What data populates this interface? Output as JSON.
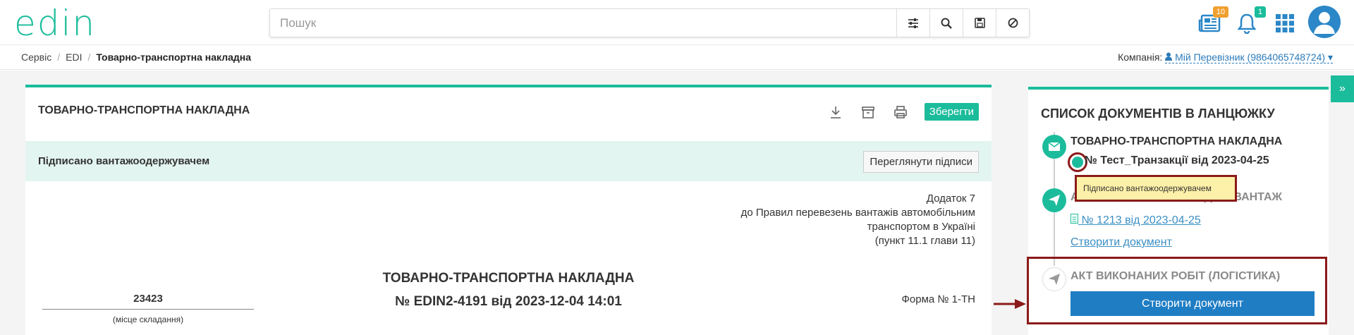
{
  "header": {
    "logo_text": "edin",
    "search_placeholder": "Пошук",
    "news_badge": "10",
    "notif_badge": "1"
  },
  "breadcrumb": [
    "Сервіс",
    "EDI",
    "Товарно-транспортна накладна"
  ],
  "company": {
    "label": "Компанія:",
    "value": "Мій Перевізник (9864065748724)"
  },
  "document": {
    "panel_title": "ТОВАРНО-ТРАНСПОРТНА НАКЛАДНА",
    "save_label": "Зберегти",
    "status": "Підписано вантажоодержувачем",
    "view_signatures": "Переглянути підписи",
    "appendix": [
      "Додаток 7",
      "до Правил перевезень вантажів автомобільним",
      "транспортом в Україні",
      "(пункт 11.1 глави 11)"
    ],
    "title_line1": "ТОВАРНО-ТРАНСПОРТНА НАКЛАДНА",
    "title_line2": "№ EDIN2-4191 від 2023-12-04 14:01",
    "place_number": "23423",
    "place_label": "(місце складання)",
    "form_no": "Форма № 1-ТН"
  },
  "chain": {
    "title": "СПИСОК ДОКУМЕНТІВ В ЛАНЦЮЖКУ",
    "item1_title": "ТОВАРНО-ТРАНСПОРТНА НАКЛАДНА",
    "item1_doc": "№ Тест_Транзакції від 2023-04-25",
    "item1_tooltip": "Підписано вантажоодержувачем",
    "item2_title": "АКТ ПРИЙМАННЯ-ПЕРЕДАЧІ ВАНТАЖ",
    "item2_doc": " № 1213 від 2023-04-25",
    "item2_create": "Створити документ",
    "item3_title": "АКТ ВИКОНАНИХ РОБІТ (ЛОГІСТИКА)",
    "item3_create": "Створити документ"
  },
  "colors": {
    "accent": "#1bbc9b",
    "badge_orange": "#f0a030",
    "badge_green": "#1bbc9b",
    "primary_blue": "#1f7dc4",
    "highlight_red": "#8b1a1a"
  }
}
